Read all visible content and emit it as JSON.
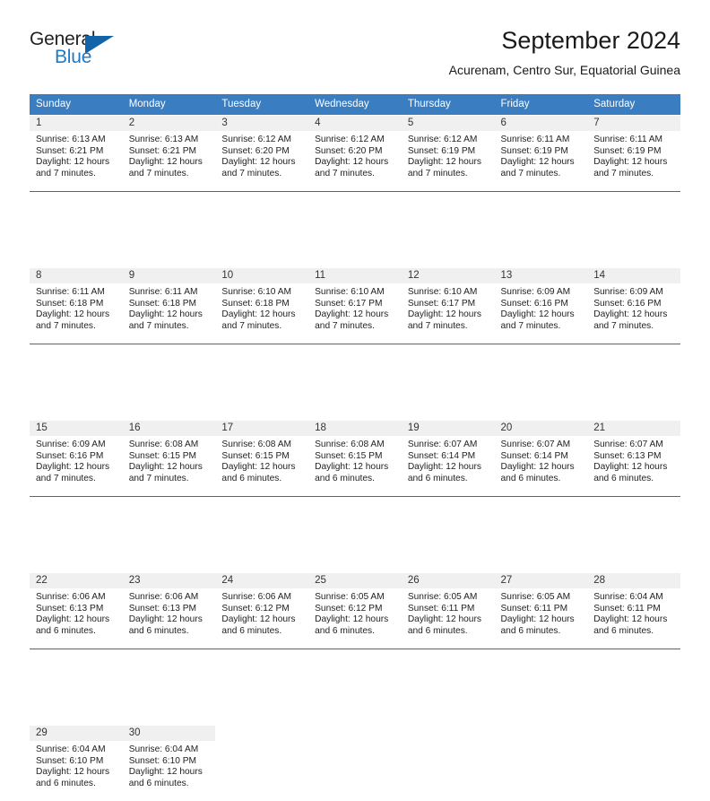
{
  "brand": {
    "name_part1": "General",
    "name_part2": "Blue",
    "triangle_color": "#1263a8",
    "blue_color": "#1f7ac4"
  },
  "header": {
    "title": "September 2024",
    "subtitle": "Acurenam, Centro Sur, Equatorial Guinea"
  },
  "colors": {
    "header_row_bg": "#3a7dc0",
    "daynum_bg": "#f0f0f0",
    "week_rule": "#2f6fae",
    "text": "#222222"
  },
  "weekday_headers": [
    "Sunday",
    "Monday",
    "Tuesday",
    "Wednesday",
    "Thursday",
    "Friday",
    "Saturday"
  ],
  "weeks": [
    [
      {
        "day": "1",
        "sunrise": "Sunrise: 6:13 AM",
        "sunset": "Sunset: 6:21 PM",
        "daylight1": "Daylight: 12 hours",
        "daylight2": "and 7 minutes."
      },
      {
        "day": "2",
        "sunrise": "Sunrise: 6:13 AM",
        "sunset": "Sunset: 6:21 PM",
        "daylight1": "Daylight: 12 hours",
        "daylight2": "and 7 minutes."
      },
      {
        "day": "3",
        "sunrise": "Sunrise: 6:12 AM",
        "sunset": "Sunset: 6:20 PM",
        "daylight1": "Daylight: 12 hours",
        "daylight2": "and 7 minutes."
      },
      {
        "day": "4",
        "sunrise": "Sunrise: 6:12 AM",
        "sunset": "Sunset: 6:20 PM",
        "daylight1": "Daylight: 12 hours",
        "daylight2": "and 7 minutes."
      },
      {
        "day": "5",
        "sunrise": "Sunrise: 6:12 AM",
        "sunset": "Sunset: 6:19 PM",
        "daylight1": "Daylight: 12 hours",
        "daylight2": "and 7 minutes."
      },
      {
        "day": "6",
        "sunrise": "Sunrise: 6:11 AM",
        "sunset": "Sunset: 6:19 PM",
        "daylight1": "Daylight: 12 hours",
        "daylight2": "and 7 minutes."
      },
      {
        "day": "7",
        "sunrise": "Sunrise: 6:11 AM",
        "sunset": "Sunset: 6:19 PM",
        "daylight1": "Daylight: 12 hours",
        "daylight2": "and 7 minutes."
      }
    ],
    [
      {
        "day": "8",
        "sunrise": "Sunrise: 6:11 AM",
        "sunset": "Sunset: 6:18 PM",
        "daylight1": "Daylight: 12 hours",
        "daylight2": "and 7 minutes."
      },
      {
        "day": "9",
        "sunrise": "Sunrise: 6:11 AM",
        "sunset": "Sunset: 6:18 PM",
        "daylight1": "Daylight: 12 hours",
        "daylight2": "and 7 minutes."
      },
      {
        "day": "10",
        "sunrise": "Sunrise: 6:10 AM",
        "sunset": "Sunset: 6:18 PM",
        "daylight1": "Daylight: 12 hours",
        "daylight2": "and 7 minutes."
      },
      {
        "day": "11",
        "sunrise": "Sunrise: 6:10 AM",
        "sunset": "Sunset: 6:17 PM",
        "daylight1": "Daylight: 12 hours",
        "daylight2": "and 7 minutes."
      },
      {
        "day": "12",
        "sunrise": "Sunrise: 6:10 AM",
        "sunset": "Sunset: 6:17 PM",
        "daylight1": "Daylight: 12 hours",
        "daylight2": "and 7 minutes."
      },
      {
        "day": "13",
        "sunrise": "Sunrise: 6:09 AM",
        "sunset": "Sunset: 6:16 PM",
        "daylight1": "Daylight: 12 hours",
        "daylight2": "and 7 minutes."
      },
      {
        "day": "14",
        "sunrise": "Sunrise: 6:09 AM",
        "sunset": "Sunset: 6:16 PM",
        "daylight1": "Daylight: 12 hours",
        "daylight2": "and 7 minutes."
      }
    ],
    [
      {
        "day": "15",
        "sunrise": "Sunrise: 6:09 AM",
        "sunset": "Sunset: 6:16 PM",
        "daylight1": "Daylight: 12 hours",
        "daylight2": "and 7 minutes."
      },
      {
        "day": "16",
        "sunrise": "Sunrise: 6:08 AM",
        "sunset": "Sunset: 6:15 PM",
        "daylight1": "Daylight: 12 hours",
        "daylight2": "and 7 minutes."
      },
      {
        "day": "17",
        "sunrise": "Sunrise: 6:08 AM",
        "sunset": "Sunset: 6:15 PM",
        "daylight1": "Daylight: 12 hours",
        "daylight2": "and 6 minutes."
      },
      {
        "day": "18",
        "sunrise": "Sunrise: 6:08 AM",
        "sunset": "Sunset: 6:15 PM",
        "daylight1": "Daylight: 12 hours",
        "daylight2": "and 6 minutes."
      },
      {
        "day": "19",
        "sunrise": "Sunrise: 6:07 AM",
        "sunset": "Sunset: 6:14 PM",
        "daylight1": "Daylight: 12 hours",
        "daylight2": "and 6 minutes."
      },
      {
        "day": "20",
        "sunrise": "Sunrise: 6:07 AM",
        "sunset": "Sunset: 6:14 PM",
        "daylight1": "Daylight: 12 hours",
        "daylight2": "and 6 minutes."
      },
      {
        "day": "21",
        "sunrise": "Sunrise: 6:07 AM",
        "sunset": "Sunset: 6:13 PM",
        "daylight1": "Daylight: 12 hours",
        "daylight2": "and 6 minutes."
      }
    ],
    [
      {
        "day": "22",
        "sunrise": "Sunrise: 6:06 AM",
        "sunset": "Sunset: 6:13 PM",
        "daylight1": "Daylight: 12 hours",
        "daylight2": "and 6 minutes."
      },
      {
        "day": "23",
        "sunrise": "Sunrise: 6:06 AM",
        "sunset": "Sunset: 6:13 PM",
        "daylight1": "Daylight: 12 hours",
        "daylight2": "and 6 minutes."
      },
      {
        "day": "24",
        "sunrise": "Sunrise: 6:06 AM",
        "sunset": "Sunset: 6:12 PM",
        "daylight1": "Daylight: 12 hours",
        "daylight2": "and 6 minutes."
      },
      {
        "day": "25",
        "sunrise": "Sunrise: 6:05 AM",
        "sunset": "Sunset: 6:12 PM",
        "daylight1": "Daylight: 12 hours",
        "daylight2": "and 6 minutes."
      },
      {
        "day": "26",
        "sunrise": "Sunrise: 6:05 AM",
        "sunset": "Sunset: 6:11 PM",
        "daylight1": "Daylight: 12 hours",
        "daylight2": "and 6 minutes."
      },
      {
        "day": "27",
        "sunrise": "Sunrise: 6:05 AM",
        "sunset": "Sunset: 6:11 PM",
        "daylight1": "Daylight: 12 hours",
        "daylight2": "and 6 minutes."
      },
      {
        "day": "28",
        "sunrise": "Sunrise: 6:04 AM",
        "sunset": "Sunset: 6:11 PM",
        "daylight1": "Daylight: 12 hours",
        "daylight2": "and 6 minutes."
      }
    ],
    [
      {
        "day": "29",
        "sunrise": "Sunrise: 6:04 AM",
        "sunset": "Sunset: 6:10 PM",
        "daylight1": "Daylight: 12 hours",
        "daylight2": "and 6 minutes."
      },
      {
        "day": "30",
        "sunrise": "Sunrise: 6:04 AM",
        "sunset": "Sunset: 6:10 PM",
        "daylight1": "Daylight: 12 hours",
        "daylight2": "and 6 minutes."
      },
      {
        "day": "",
        "sunrise": "",
        "sunset": "",
        "daylight1": "",
        "daylight2": ""
      },
      {
        "day": "",
        "sunrise": "",
        "sunset": "",
        "daylight1": "",
        "daylight2": ""
      },
      {
        "day": "",
        "sunrise": "",
        "sunset": "",
        "daylight1": "",
        "daylight2": ""
      },
      {
        "day": "",
        "sunrise": "",
        "sunset": "",
        "daylight1": "",
        "daylight2": ""
      },
      {
        "day": "",
        "sunrise": "",
        "sunset": "",
        "daylight1": "",
        "daylight2": ""
      }
    ]
  ]
}
